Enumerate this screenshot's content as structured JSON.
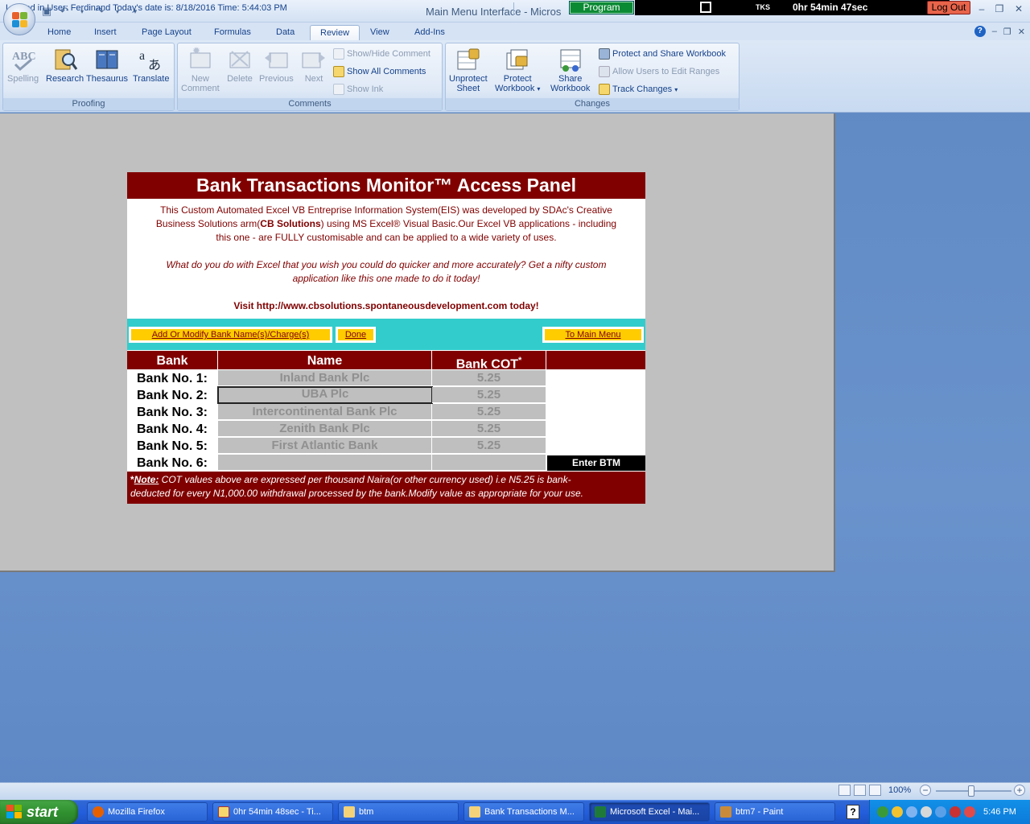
{
  "window": {
    "title": "Main Menu Interface - Micros",
    "program_label": "Program",
    "user_code": "TKS",
    "timer": "0hr 54min 47sec",
    "logout_label": "Log Out"
  },
  "ribbon": {
    "tabs": [
      "Home",
      "Insert",
      "Page Layout",
      "Formulas",
      "Data",
      "Review",
      "View",
      "Add-Ins"
    ],
    "active_tab": "Review",
    "proofing": {
      "label": "Proofing",
      "buttons": [
        "Spelling",
        "Research",
        "Thesaurus",
        "Translate"
      ]
    },
    "comments": {
      "label": "Comments",
      "new_comment": "New Comment",
      "new_comment_line1": "New",
      "new_comment_line2": "Comment",
      "delete": "Delete",
      "previous": "Previous",
      "next": "Next",
      "show_hide": "Show/Hide Comment",
      "show_all": "Show All Comments",
      "show_ink": "Show Ink"
    },
    "changes": {
      "label": "Changes",
      "unprotect_line1": "Unprotect",
      "unprotect_line2": "Sheet",
      "protect_line1": "Protect",
      "protect_line2": "Workbook",
      "share_line1": "Share",
      "share_line2": "Workbook",
      "protect_share": "Protect and Share Workbook",
      "allow_users": "Allow Users to Edit Ranges",
      "track_changes": "Track Changes"
    }
  },
  "panel": {
    "title": "Bank Transactions Monitor™ Access Panel",
    "intro_line1": "This Custom Automated Excel VB Entreprise Information System(EIS) was developed by SDAc's Creative",
    "intro_line2a": "Business Solutions arm(",
    "intro_bold": "CB Solutions",
    "intro_line2b": ") using MS Excel® Visual Basic.Our Excel VB applications - including",
    "intro_line3": "this one - are FULLY customisable and can be applied to a wide variety of uses.",
    "question_line1": "What do you do with Excel that you wish you could do quicker and more accurately? Get a nifty  custom",
    "question_line2": "application like this one made to do it today!",
    "visit": "Visit http://www.cbsolutions.spontaneousdevelopment.com today!",
    "buttons": {
      "add_modify": "Add Or Modify Bank Name(s)/Charge(s)",
      "done": "Done",
      "main_menu": "To Main Menu"
    },
    "table": {
      "headers": [
        "Bank",
        "Name",
        "Bank COT"
      ],
      "header_mark": "*",
      "rows": [
        {
          "label": "Bank No. 1:",
          "name": "Inland Bank Plc",
          "cot": "5.25"
        },
        {
          "label": "Bank No. 2:",
          "name": "UBA Plc",
          "cot": "5.25"
        },
        {
          "label": "Bank No. 3:",
          "name": "Intercontinental Bank Plc",
          "cot": "5.25"
        },
        {
          "label": "Bank No. 4:",
          "name": "Zenith Bank Plc",
          "cot": "5.25"
        },
        {
          "label": "Bank No. 5:",
          "name": "First Atlantic Bank",
          "cot": "5.25"
        },
        {
          "label": "Bank No. 6:",
          "name": "",
          "cot": ""
        }
      ]
    },
    "enter_btm": "Enter BTM",
    "note_star": "*",
    "note_label": "Note:",
    "note_line1": " COT values above are expressed per thousand Naira(or other currency used) i.e N5.25 is bank-",
    "note_line2": "deducted for every N1,000.00 withdrawal processed by the bank.Modify value as appropriate for your use."
  },
  "statusbar": {
    "text": "Logged in User: Ferdinand Today's date is: 8/18/2016 Time: 5:44:03 PM",
    "zoom": "100%",
    "zoom_level": 1.0
  },
  "taskbar": {
    "start": "start",
    "tasks": [
      "Mozilla Firefox",
      "0hr 54min 48sec - Ti...",
      "btm",
      "Bank Transactions M...",
      "Microsoft Excel - Mai...",
      "btm7 - Paint"
    ],
    "active_task_index": 4,
    "clock": "5:46 PM",
    "help": "?"
  },
  "colors": {
    "maroon": "#800000",
    "cyan_band": "#33cccc",
    "yellow_button": "#ffcc00",
    "ribbon_text": "#15428b",
    "sheet_gray": "#c0c0c0"
  }
}
